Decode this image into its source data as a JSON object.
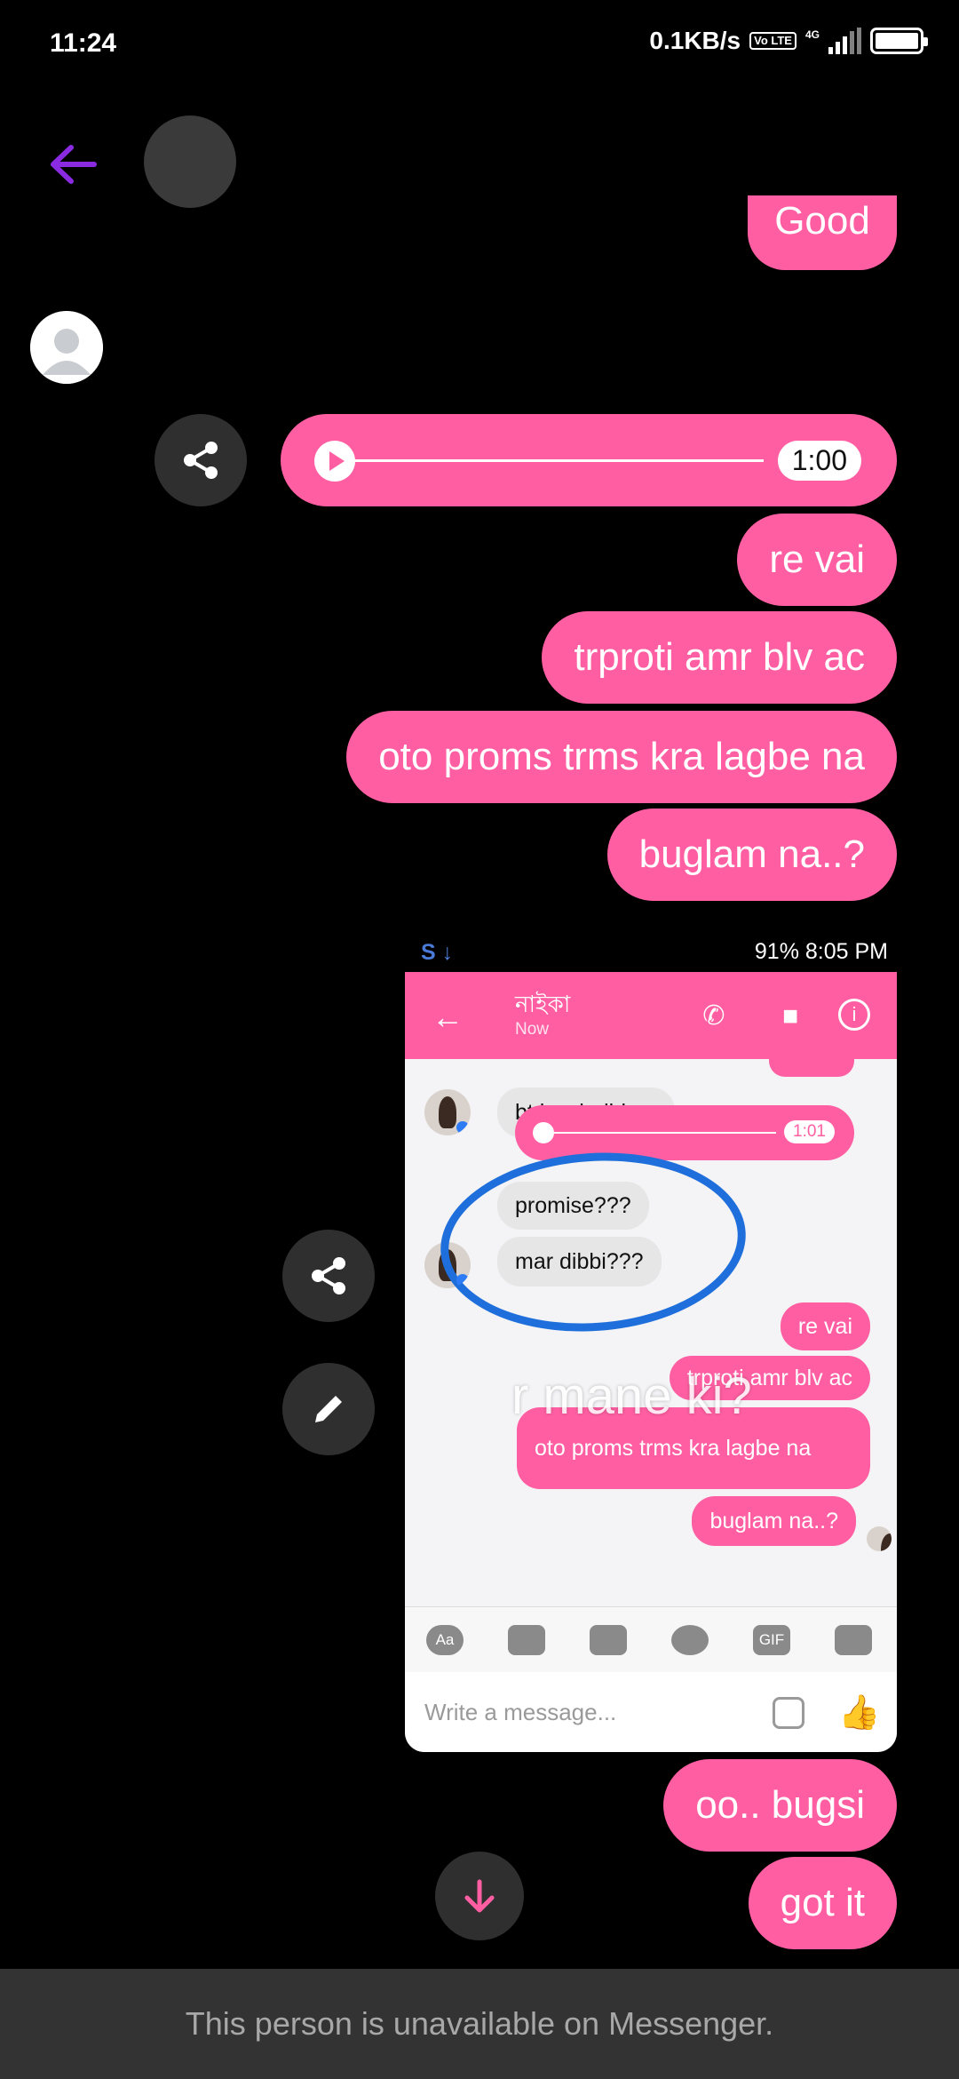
{
  "status_bar": {
    "time": "11:24",
    "net_speed": "0.1KB/s",
    "volte": "Vo LTE",
    "network": "4G"
  },
  "header": {
    "back_icon": "arrow-left-icon",
    "accent_color": "#8a2be2"
  },
  "messages": {
    "partial_top": "Good",
    "audio_duration": "1:00",
    "sent": [
      "re vai",
      "trproti amr blv ac",
      "oto proms trms kra lagbe na",
      "buglam na..?",
      "oo.. bugsi",
      "got it"
    ],
    "bubble_color": "#ff5fa2"
  },
  "screenshot": {
    "status_right": "91% 8:05 PM",
    "contact_name": "নাইকা",
    "contact_status": "Now",
    "incoming": [
      "bt kawk dbi na",
      "promise???",
      "mar dibbi???"
    ],
    "audio_duration": "1:01",
    "outgoing": [
      "re vai",
      "trproti amr blv ac",
      "oto proms trms kra lagbe na",
      "buglam na..?"
    ],
    "overlay_caption": "r mane ki?",
    "toolbar": [
      "Aa",
      "GIF"
    ],
    "input_placeholder": "Write a message..."
  },
  "footer": {
    "notice": "This person is unavailable on Messenger."
  }
}
